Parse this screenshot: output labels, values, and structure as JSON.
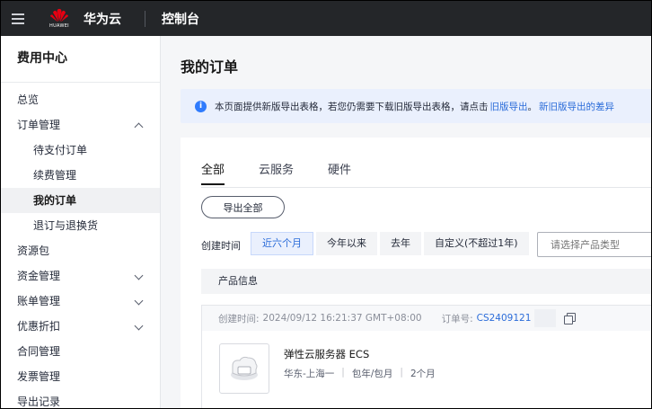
{
  "topbar": {
    "logo_text": "HUAWEI",
    "brand": "华为云",
    "console": "控制台"
  },
  "sidebar": {
    "title": "费用中心",
    "items": [
      {
        "label": "总览"
      },
      {
        "label": "订单管理"
      },
      {
        "label": "待支付订单"
      },
      {
        "label": "续费管理"
      },
      {
        "label": "我的订单"
      },
      {
        "label": "退订与退换货"
      },
      {
        "label": "资源包"
      },
      {
        "label": "资金管理"
      },
      {
        "label": "账单管理"
      },
      {
        "label": "优惠折扣"
      },
      {
        "label": "合同管理"
      },
      {
        "label": "发票管理"
      },
      {
        "label": "导出记录"
      }
    ]
  },
  "main": {
    "title": "我的订单",
    "notice": {
      "text": "本页面提供新版导出表格，若您仍需要下载旧版导出表格，请点击",
      "link1": "旧版导出",
      "link2": "新旧版导出的差异"
    },
    "tabs": [
      "全部",
      "云服务",
      "硬件"
    ],
    "export_all": "导出全部",
    "filter": {
      "label": "创建时间",
      "options": [
        "近六个月",
        "今年以来",
        "去年",
        "自定义(不超过1年)"
      ],
      "type_placeholder": "请选择产品类型"
    },
    "table_header": "产品信息",
    "order": {
      "created_label": "创建时间:",
      "created_value": "2024/09/12 16:21:37 GMT+08:00",
      "order_no_label": "订单号:",
      "order_no": "CS2409121",
      "product_name": "弹性云服务器 ECS",
      "region": "华东-上海一",
      "billing": "包年/包月",
      "duration": "2个月"
    }
  },
  "colors": {
    "topbar_bg": "#242629",
    "accent_blue": "#2b6cd9",
    "notice_bg": "#eaf0fd"
  }
}
